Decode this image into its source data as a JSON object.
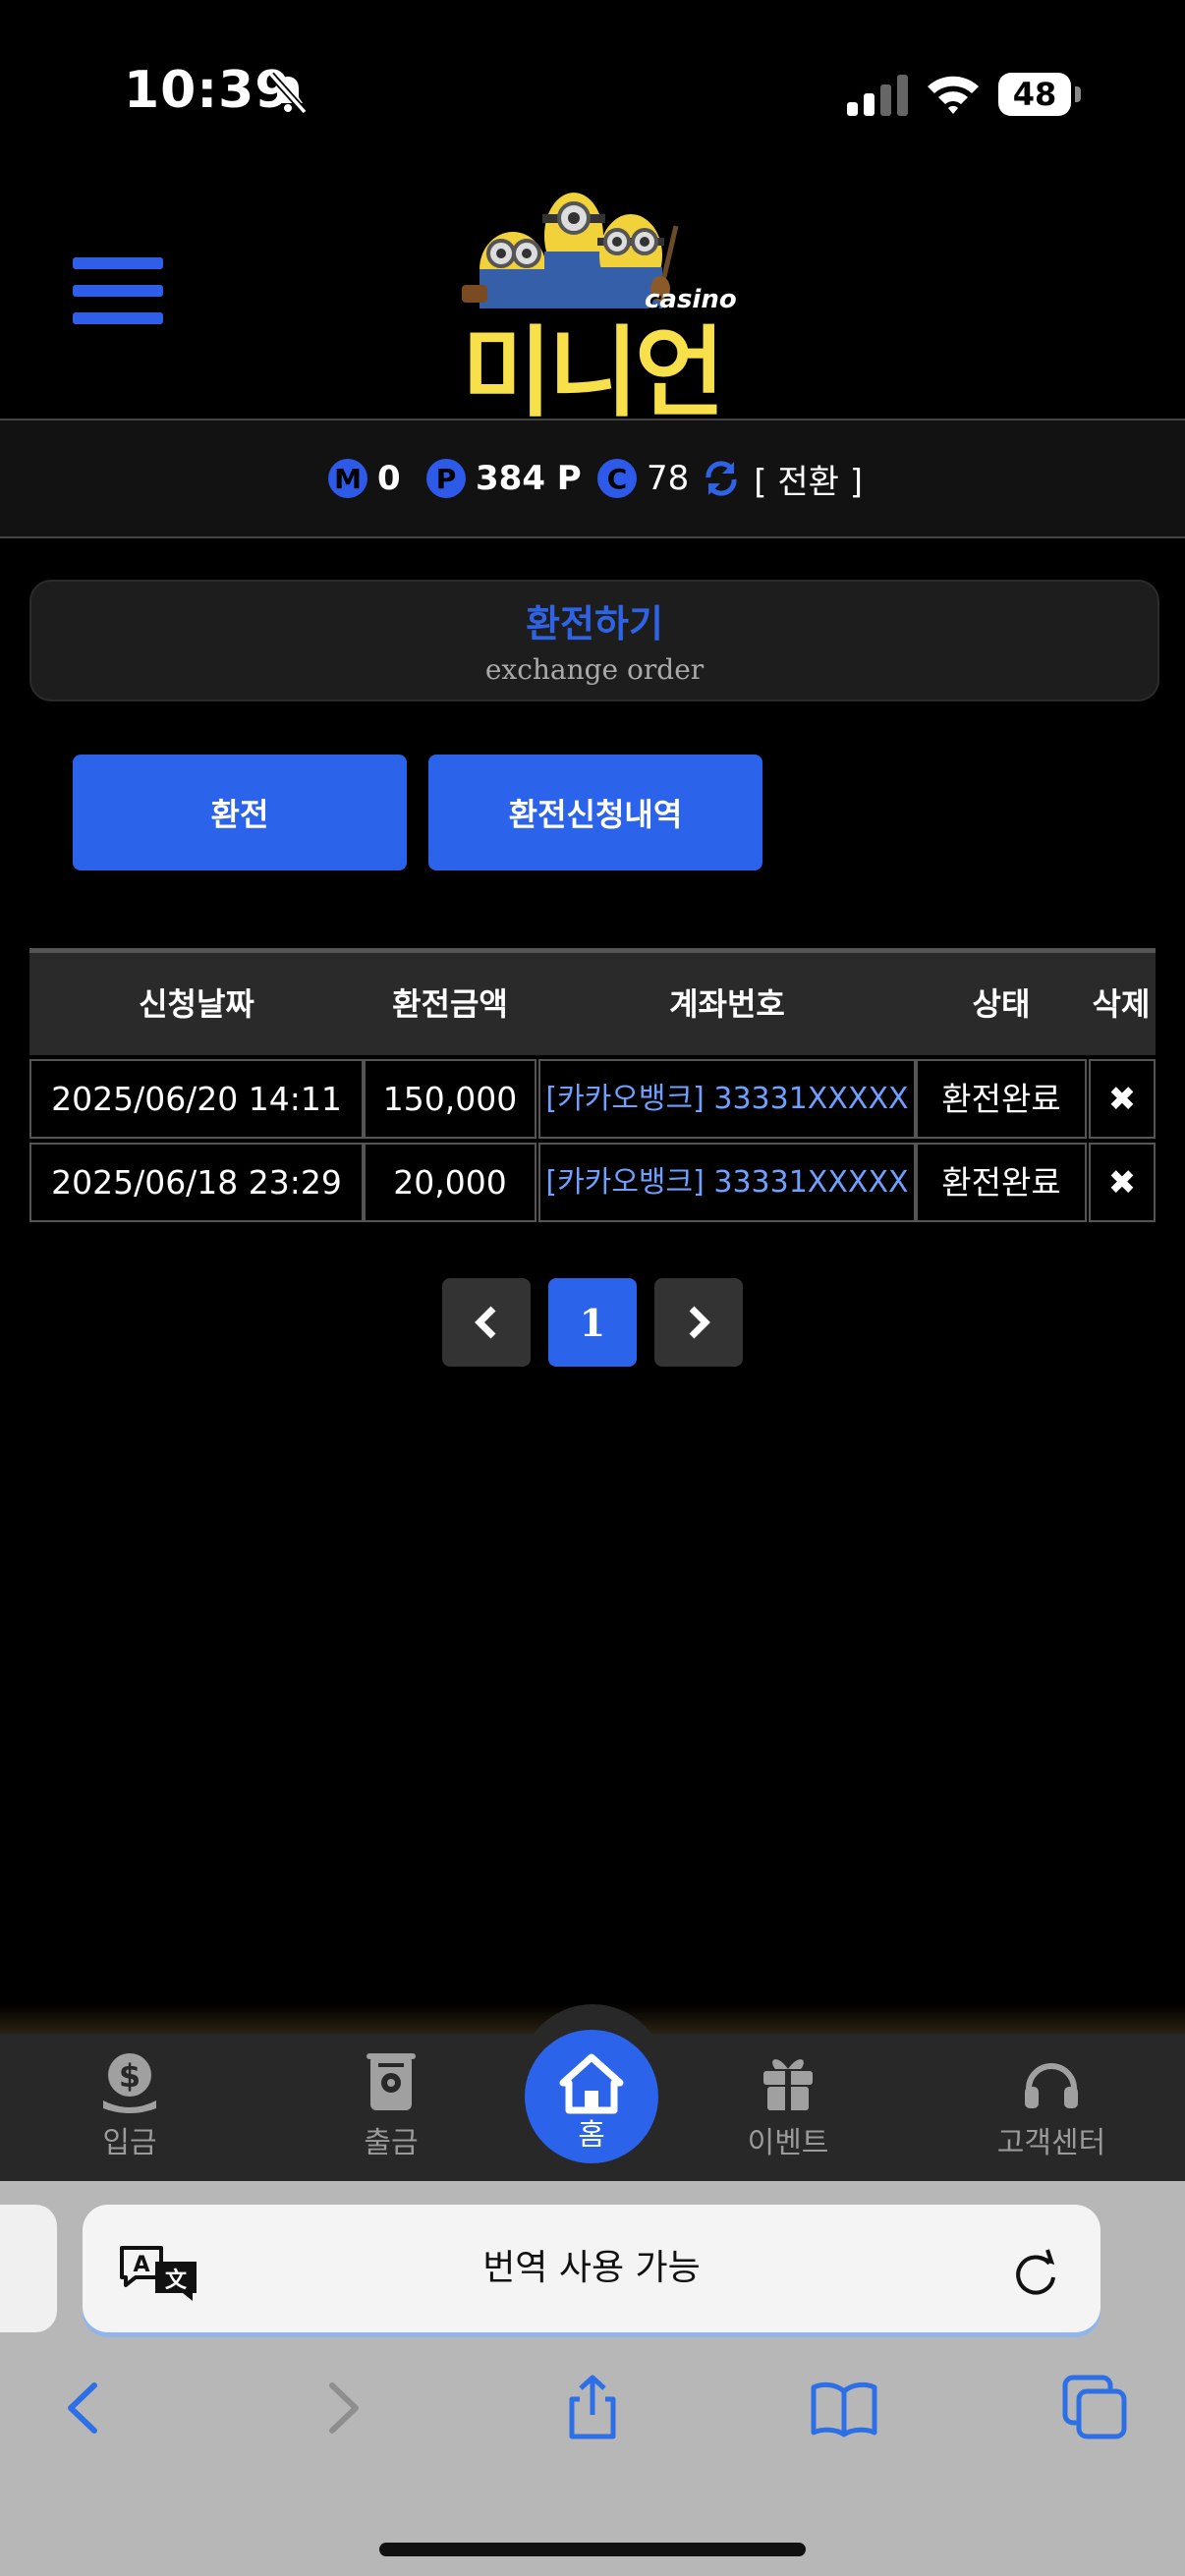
{
  "status_bar": {
    "time": "10:39",
    "battery": "48"
  },
  "logo": {
    "casino": "casino",
    "name": "미니언"
  },
  "points": {
    "m": {
      "badge": "M",
      "value": "0"
    },
    "p": {
      "badge": "P",
      "value": "384 P"
    },
    "c": {
      "badge": "C",
      "value": "78"
    },
    "convert_label": "[ 전환 ]"
  },
  "section": {
    "title": "환전하기",
    "subtitle": "exchange order"
  },
  "tabs": [
    {
      "label": "환전"
    },
    {
      "label": "환전신청내역"
    }
  ],
  "table": {
    "headers": [
      "신청날짜",
      "환전금액",
      "계좌번호",
      "상태",
      "삭제"
    ],
    "rows": [
      {
        "date": "2025/06/20 14:11",
        "amount": "150,000",
        "account": "[카카오뱅크] 33331XXXXX",
        "status": "환전완료"
      },
      {
        "date": "2025/06/18 23:29",
        "amount": "20,000",
        "account": "[카카오뱅크] 33331XXXXX",
        "status": "환전완료"
      }
    ]
  },
  "pagination": {
    "current": "1"
  },
  "bottom_nav": {
    "deposit": "입금",
    "withdraw": "출금",
    "home": "홈",
    "event": "이벤트",
    "support": "고객센터"
  },
  "safari": {
    "address_text": "번역 사용 가능"
  },
  "colors": {
    "accent": "#2b63ea",
    "logo_yellow": "#f7e04a",
    "link": "#6fa0ff"
  }
}
